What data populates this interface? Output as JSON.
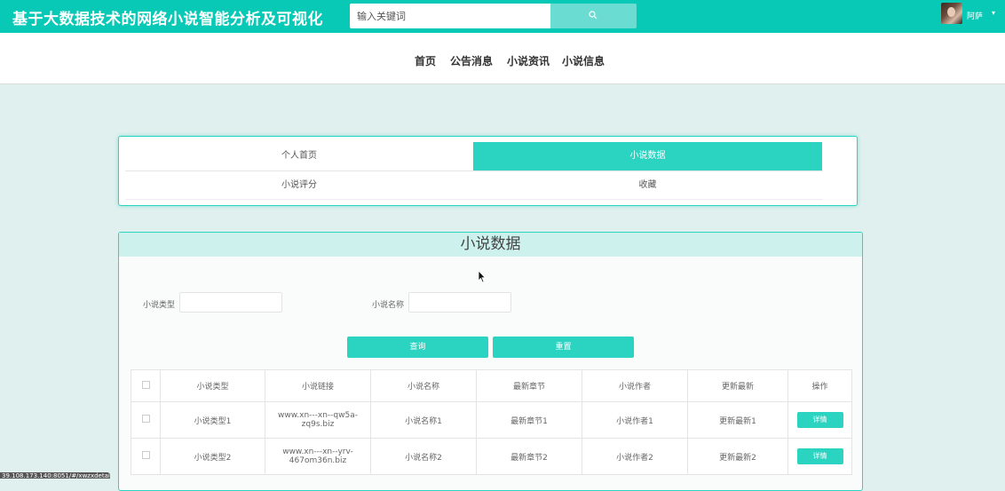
{
  "header": {
    "site_title": "基于大数据技术的网络小说智能分析及可视化",
    "search_placeholder": "输入关键词",
    "search_icon": "search-icon",
    "username": "阿萨"
  },
  "nav": {
    "items": [
      "首页",
      "公告消息",
      "小说资讯",
      "小说信息"
    ]
  },
  "tabs": {
    "items": [
      {
        "label": "个人首页",
        "active": false
      },
      {
        "label": "小说数据",
        "active": true
      },
      {
        "label": "小说评分",
        "active": false
      },
      {
        "label": "收藏",
        "active": false
      }
    ]
  },
  "panel": {
    "title": "小说数据",
    "filters": [
      {
        "label": "小说类型",
        "value": ""
      },
      {
        "label": "小说名称",
        "value": ""
      }
    ],
    "buttons": {
      "query": "查询",
      "reset": "重置"
    }
  },
  "table": {
    "columns": [
      "小说类型",
      "小说链接",
      "小说名称",
      "最新章节",
      "小说作者",
      "更新最新",
      "操作"
    ],
    "rows": [
      [
        "小说类型1",
        "www.xn---xn--qw5a-zq9s.biz",
        "小说名称1",
        "最新章节1",
        "小说作者1",
        "更新最新1"
      ],
      [
        "小说类型2",
        "www.xn---xn--yrv-467om36n.biz",
        "小说名称2",
        "最新章节2",
        "小说作者2",
        "更新最新2"
      ]
    ],
    "action_label": "详情"
  },
  "status_url": "39.108.173.140:8051/#/xwzxdetail"
}
